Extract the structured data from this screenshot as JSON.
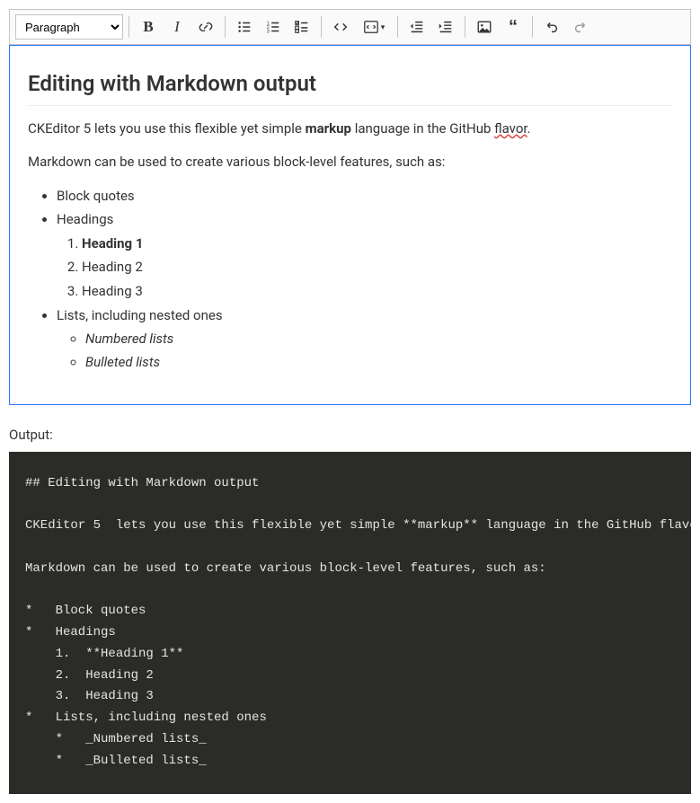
{
  "toolbar": {
    "heading_select": "Paragraph",
    "buttons": {
      "bold": "Bold",
      "italic": "Italic",
      "link": "Link",
      "bulleted": "Bulleted List",
      "numbered": "Numbered List",
      "todo": "To-do List",
      "code": "Code",
      "code_block": "Code Block",
      "outdent": "Decrease indent",
      "indent": "Increase indent",
      "image": "Insert image",
      "blockquote": "Block quote",
      "undo": "Undo",
      "redo": "Redo"
    }
  },
  "content": {
    "heading": "Editing with Markdown output",
    "p1_a": "CKEditor 5  lets you use this flexible yet simple ",
    "p1_markup": "markup",
    "p1_b": " language in the GitHub ",
    "p1_flavor": "flavor",
    "p1_c": ".",
    "p2": "Markdown can be used to create various block-level features, such as:",
    "li1": "Block quotes",
    "li2": "Headings",
    "h1": "Heading 1",
    "h2": "Heading 2",
    "h3": "Heading 3",
    "li3": "Lists, including nested ones",
    "sub_num": "Numbered lists",
    "sub_bul": "Bulleted lists"
  },
  "output_label": "Output:",
  "output_code": "## Editing with Markdown output\n\nCKEditor 5  lets you use this flexible yet simple **markup** language in the GitHub flavor.\n\nMarkdown can be used to create various block-level features, such as:\n\n*   Block quotes\n*   Headings\n    1.  **Heading 1**\n    2.  Heading 2\n    3.  Heading 3\n*   Lists, including nested ones\n    *   _Numbered lists_\n    *   _Bulleted lists_"
}
